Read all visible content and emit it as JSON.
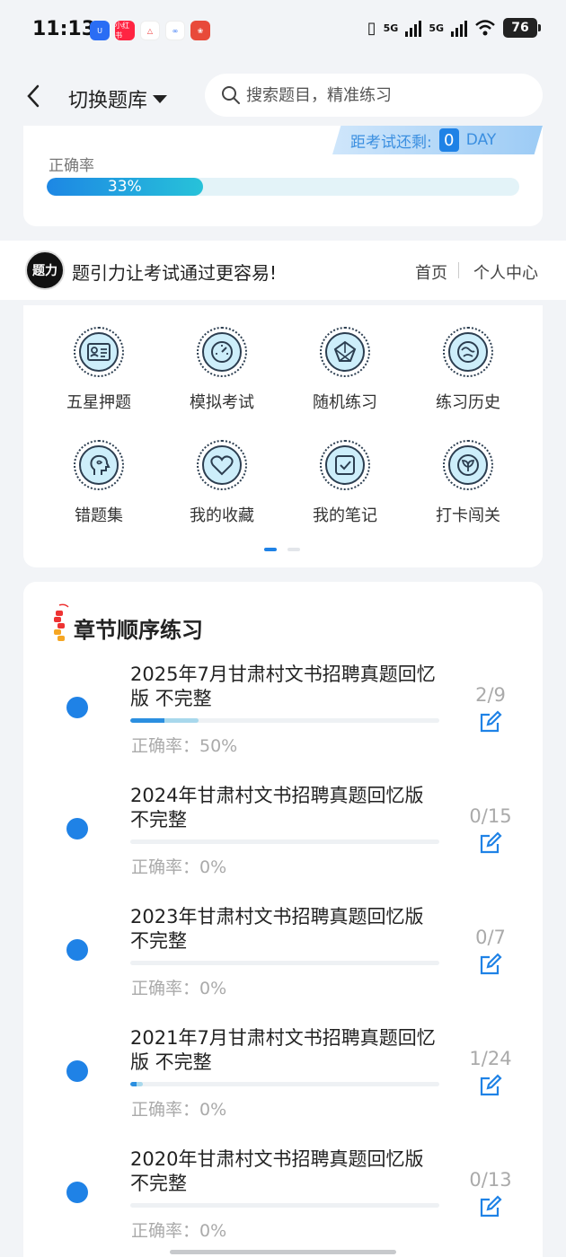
{
  "status": {
    "time": "11:13",
    "battery": "76",
    "net1": "5G",
    "net2": "5G",
    "app_badges": [
      "U",
      "小红书",
      "△",
      "∞",
      "❀"
    ]
  },
  "header": {
    "switch_label": "切换题库",
    "search_placeholder": "搜索题目，精准练习"
  },
  "stats": {
    "countdown_label": "距考试还剩:",
    "countdown_value": "0",
    "countdown_unit": "DAY",
    "accuracy_label": "正确率",
    "accuracy_text": "33%",
    "accuracy_fraction": 0.33
  },
  "slogan_bar": {
    "logo_text": "题引力",
    "slogan": "题引力让考试通过更容易!",
    "nav_home": "首页",
    "nav_profile": "个人中心"
  },
  "features": [
    {
      "label": "五星押题",
      "icon": "id-card-icon"
    },
    {
      "label": "模拟考试",
      "icon": "gauge-icon"
    },
    {
      "label": "随机练习",
      "icon": "shuffle-icon"
    },
    {
      "label": "练习历史",
      "icon": "history-icon"
    },
    {
      "label": "错题集",
      "icon": "head-icon"
    },
    {
      "label": "我的收藏",
      "icon": "heart-icon"
    },
    {
      "label": "我的笔记",
      "icon": "note-icon"
    },
    {
      "label": "打卡闯关",
      "icon": "leaf-icon"
    }
  ],
  "chapters": {
    "title": "章节顺序练习",
    "items": [
      {
        "title": "2025年7月甘肃村文书招聘真题回忆版 不完整",
        "count": "2/9",
        "accuracy": "正确率：50%",
        "progress": 0.22
      },
      {
        "title": "2024年甘肃村文书招聘真题回忆版 不完整",
        "count": "0/15",
        "accuracy": "正确率：0%",
        "progress": 0
      },
      {
        "title": "2023年甘肃村文书招聘真题回忆版 不完整",
        "count": "0/7",
        "accuracy": "正确率：0%",
        "progress": 0
      },
      {
        "title": "2021年7月甘肃村文书招聘真题回忆版 不完整",
        "count": "1/24",
        "accuracy": "正确率：0%",
        "progress": 0.04
      },
      {
        "title": "2020年甘肃村文书招聘真题回忆版 不完整",
        "count": "0/13",
        "accuracy": "正确率：0%",
        "progress": 0
      }
    ]
  },
  "colors": {
    "accent": "#1f82e6",
    "teal": "#27c2d9",
    "progress_light": "#a8d8ec"
  }
}
